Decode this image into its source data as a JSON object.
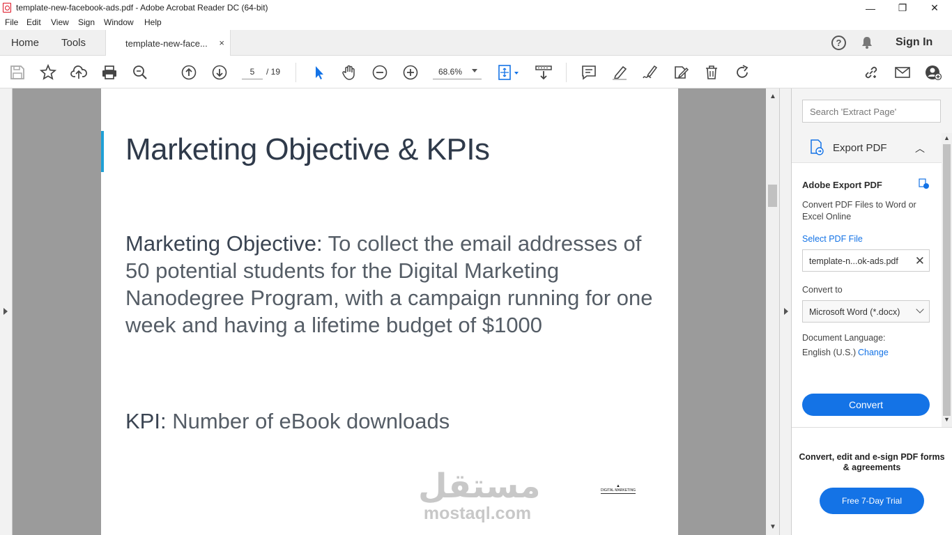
{
  "window": {
    "title": "template-new-facebook-ads.pdf - Adobe Acrobat Reader DC (64-bit)",
    "controls": {
      "minimize": "—",
      "restore": "❐",
      "close": "✕"
    }
  },
  "menu": [
    "File",
    "Edit",
    "View",
    "Sign",
    "Window",
    "Help"
  ],
  "tabs": {
    "home": "Home",
    "tools": "Tools",
    "document": "template-new-face...",
    "document_close": "×",
    "sign_in": "Sign In",
    "help": "?"
  },
  "toolbar": {
    "current_page": "5",
    "total_pages": "/ 19",
    "zoom": "68.6%"
  },
  "page": {
    "title": "Marketing Objective & KPIs",
    "objective_label": "Marketing Objective:",
    "objective_text": " To collect the email addresses of 50 potential students for the Digital Marketing Nanodegree Program, with a campaign running for one week and having a lifetime budget of $1000",
    "kpi_label": "KPI:",
    "kpi_text": " Number of eBook downloads",
    "logo_text": "DIGITAL MARKETING"
  },
  "watermark": {
    "arabic": "مستقل",
    "latin": "mostaql.com"
  },
  "right_pane": {
    "search_placeholder": "Search 'Extract Page'",
    "export_title": "Export PDF",
    "adobe_export_heading": "Adobe Export PDF",
    "description": "Convert PDF Files to Word or Excel Online",
    "select_file_label": "Select PDF File",
    "selected_file": "template-n...ok-ads.pdf",
    "convert_to_label": "Convert to",
    "format": "Microsoft Word (*.docx)",
    "doc_language_label": "Document Language:",
    "doc_language": "English (U.S.)",
    "change_link": "Change",
    "convert_button": "Convert",
    "promo_text": "Convert, edit and e-sign PDF forms & agreements",
    "trial_button": "Free 7-Day Trial"
  },
  "colors": {
    "accent_blue": "#1473e6",
    "slide_accent": "#1fa0d6",
    "doc_bg": "#9b9b9b"
  }
}
